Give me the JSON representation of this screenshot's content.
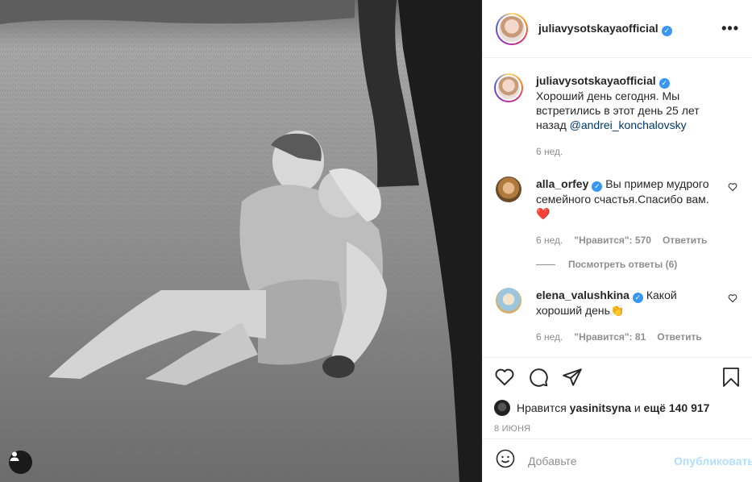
{
  "post": {
    "author": "juliavysotskayaofficial",
    "verified_mark": "✓",
    "more_icon": "•••"
  },
  "caption": {
    "user": "juliavysotskayaofficial",
    "text": "Хороший день сегодня. Мы встретились в этот день 25 лет назад",
    "mention": "@andrei_konchalovsky",
    "time": "6 нед."
  },
  "comments": [
    {
      "user": "alla_orfey",
      "text": "Вы пример мудрого семейного счастья.Спасибо вам.❤️",
      "time": "6 нед.",
      "likes": "\"Нравится\": 570",
      "reply": "Ответить",
      "view_replies": "Посмотреть ответы (6)"
    },
    {
      "user": "elena_valushkina",
      "text": "Какой хороший день👏",
      "time": "6 нед.",
      "likes": "\"Нравится\": 81",
      "reply": "Ответить"
    }
  ],
  "likes_line": {
    "prefix": "Нравится",
    "user": "yasinitsyna",
    "middle": "и",
    "rest": "ещё 140 917"
  },
  "date": "8 ИЮНЯ",
  "add_comment": {
    "placeholder": "Добавьте",
    "publish": "Опубликовать"
  },
  "colors": {
    "verified": "#3897f0",
    "heart_emoji": "#e0245e",
    "publish_disabled": "#b2dffc"
  },
  "icons": [
    "heart-icon",
    "comment-icon",
    "share-icon",
    "bookmark-icon",
    "emoji-icon",
    "user-tag-icon",
    "more-icon"
  ]
}
